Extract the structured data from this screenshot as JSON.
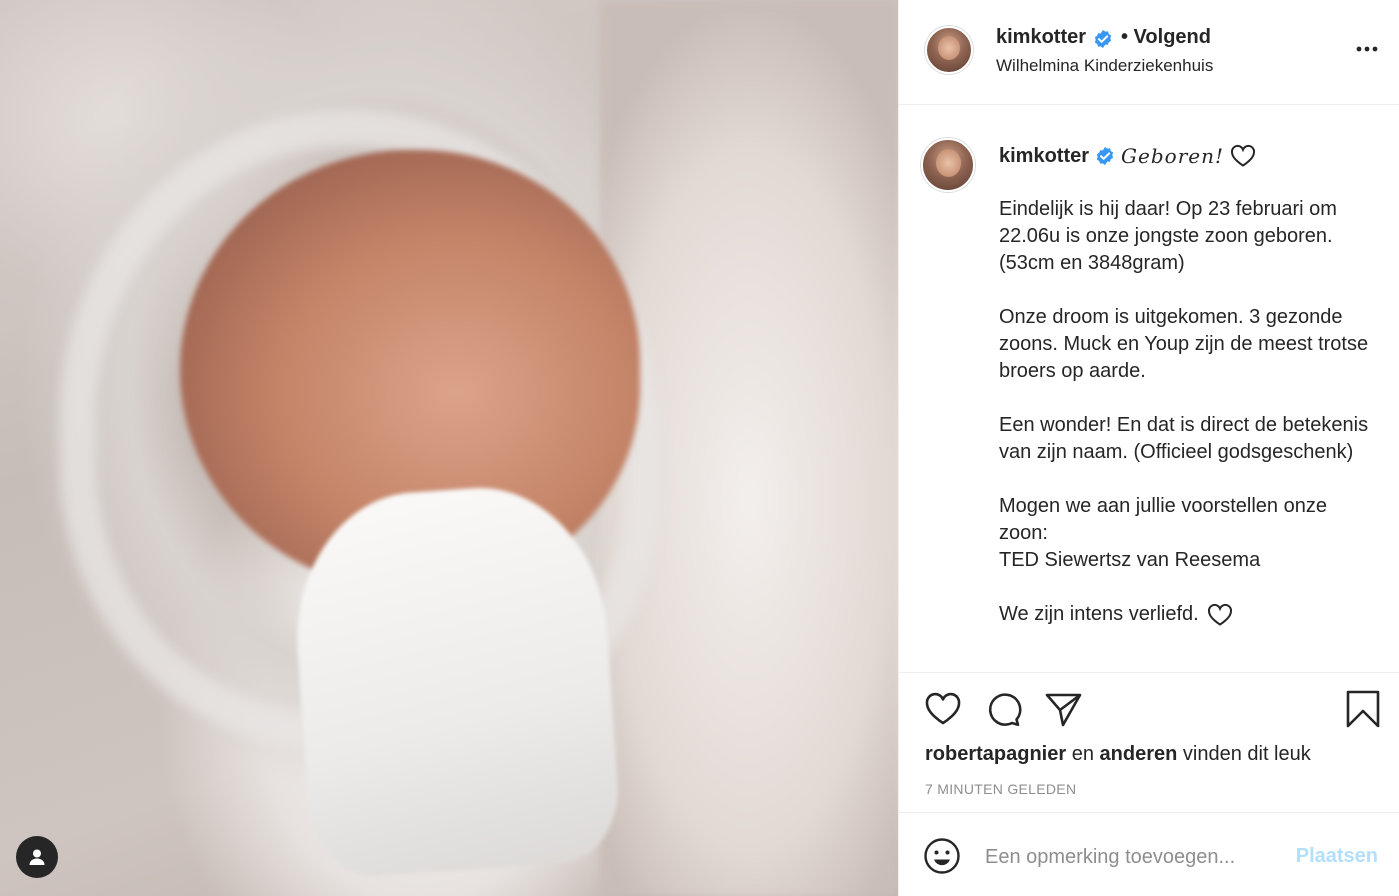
{
  "post": {
    "image_alt": "Newborn baby wrapped in white blanket"
  },
  "header": {
    "username": "kimkotter",
    "follow_status": "• Volgend",
    "location": "Wilhelmina Kinderziekenhuis",
    "more_icon": "more-horizontal-icon"
  },
  "caption": {
    "username": "kimkotter",
    "title": "Geboren!",
    "paragraphs": [
      "Eindelijk is hij daar! Op 23 februari om 22.06u is onze jongste zoon geboren. (53cm en 3848gram)",
      "Onze droom is uitgekomen. 3 gezonde zoons. Muck en Youp zijn de meest trotse broers op aarde.",
      "Een wonder! En dat is direct de betekenis van zijn naam. (Officieel godsgeschenk)",
      "Mogen we aan jullie voorstellen onze zoon:\nTED Siewertsz van Reesema",
      "We zijn intens verliefd."
    ]
  },
  "likes": {
    "user": "robertapagnier",
    "and": " en ",
    "others": "anderen",
    "suffix": " vinden dit leuk"
  },
  "timestamp": "7 MINUTEN GELEDEN",
  "comment": {
    "placeholder": "Een opmerking toevoegen...",
    "post_label": "Plaatsen"
  },
  "colors": {
    "verified": "#3897f0",
    "post_button": "#b2dffc",
    "muted": "#8e8e8e"
  }
}
